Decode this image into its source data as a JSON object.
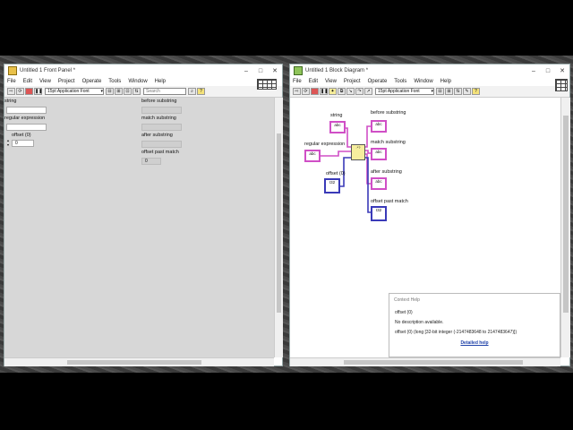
{
  "front_panel": {
    "title": "Untitled 1 Front Panel *",
    "menu": [
      "File",
      "Edit",
      "View",
      "Project",
      "Operate",
      "Tools",
      "Window",
      "Help"
    ],
    "font": "15pt Application Font",
    "search_placeholder": "Search",
    "controls": {
      "string": "string",
      "regex": "regular expression",
      "offset": "offset (0)",
      "offset_value": "0"
    },
    "indicators": {
      "before": "before substring",
      "match": "match substring",
      "after": "after substring",
      "past": "offset past match",
      "past_value": "0"
    }
  },
  "block_diagram": {
    "title": "Untitled 1 Block Diagram *",
    "menu": [
      "File",
      "Edit",
      "View",
      "Project",
      "Operate",
      "Tools",
      "Window",
      "Help"
    ],
    "font": "15pt Application Font",
    "labels": {
      "string": "string",
      "regex": "regular expression",
      "offset": "offset (0)",
      "before": "before substring",
      "match": "match substring",
      "after": "after substring",
      "past": "offset past match"
    },
    "term_text": {
      "abc": "abc",
      "i32": "I32"
    },
    "context_help": {
      "title": "Context Help",
      "heading": "offset (0)",
      "description": "No description available.",
      "detail": "offset (0) (long [32-bit integer (-2147483648 to 2147483647)])",
      "link": "Detailed help"
    }
  },
  "colors": {
    "string_wire": "#d04fc6",
    "integer_wire": "#3a3ab8",
    "panel_bg": "#d7d7d7"
  }
}
